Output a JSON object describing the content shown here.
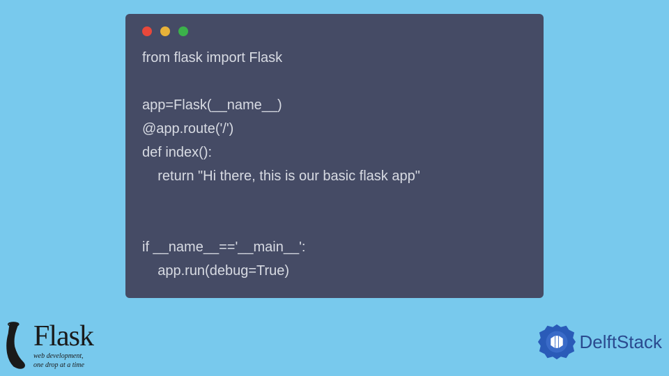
{
  "code": {
    "line1": "from flask import Flask",
    "line2": "",
    "line3": "app=Flask(__name__)",
    "line4": "@app.route('/')",
    "line5": "def index():",
    "line6": "    return \"Hi there, this is our basic flask app\"",
    "line7": "",
    "line8": "",
    "line9": "if __name__=='__main__':",
    "line10": "    app.run(debug=True)"
  },
  "flask": {
    "title": "Flask",
    "tagline1": "web development,",
    "tagline2": "one drop at a time"
  },
  "delft": {
    "text": "DelftStack"
  },
  "colors": {
    "bg": "#78c9ed",
    "window": "#454b65",
    "code_text": "#d8dbe3",
    "dot_red": "#e8483b",
    "dot_yellow": "#e8b239",
    "dot_green": "#3bb24a",
    "delft_blue": "#2a4a8f"
  }
}
